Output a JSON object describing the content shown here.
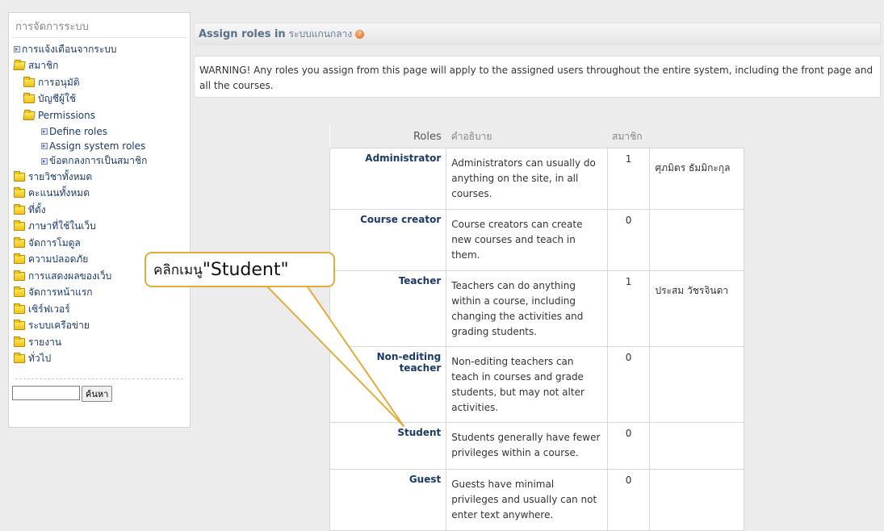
{
  "sidebar": {
    "title": "การจัดการระบบ",
    "items": [
      {
        "label": "การแจ้งเตือนจากระบบ",
        "icon": "doc-icon"
      },
      {
        "label": "สมาชิก",
        "icon": "folder-open-icon"
      },
      {
        "label": "การอนุมัติ",
        "icon": "folder-icon"
      },
      {
        "label": "บัญชีผู้ใช้",
        "icon": "folder-icon"
      },
      {
        "label": "Permissions",
        "icon": "folder-open-icon"
      },
      {
        "label": "Define roles",
        "icon": "doc-icon"
      },
      {
        "label": "Assign system roles",
        "icon": "doc-icon"
      },
      {
        "label": "ข้อตกลงการเป็นสมาชิก",
        "icon": "doc-icon"
      },
      {
        "label": "รายวิชาทั้งหมด",
        "icon": "folder-icon"
      },
      {
        "label": "คะแนนทั้งหมด",
        "icon": "folder-icon"
      },
      {
        "label": "ที่ตั้ง",
        "icon": "folder-icon"
      },
      {
        "label": "ภาษาที่ใช้ในเว็บ",
        "icon": "folder-icon"
      },
      {
        "label": "จัดการโมดูล",
        "icon": "folder-icon"
      },
      {
        "label": "ความปลอดภัย",
        "icon": "folder-icon"
      },
      {
        "label": "การแสดงผลของเว็บ",
        "icon": "folder-icon"
      },
      {
        "label": "จัดการหน้าแรก",
        "icon": "folder-icon"
      },
      {
        "label": "เซิร์ฟเวอร์",
        "icon": "folder-icon"
      },
      {
        "label": "ระบบเครือข่าย",
        "icon": "folder-icon"
      },
      {
        "label": "รายงาน",
        "icon": "folder-icon"
      },
      {
        "label": "ทั่วไป",
        "icon": "folder-icon"
      }
    ],
    "search": {
      "value": "",
      "button_label": "ค้นหา"
    }
  },
  "header": {
    "title": "Assign roles in",
    "context": "ระบบแกนกลาง",
    "help_icon": "help-icon"
  },
  "warning": "WARNING! Any roles you assign from this page will apply to the assigned users throughout the entire system, including the front page and all the courses.",
  "roles_table": {
    "headers": {
      "role": "Roles",
      "description": "คำอธิบาย",
      "members": "สมาชิก"
    },
    "rows": [
      {
        "name": "Administrator",
        "description": "Administrators can usually do anything on the site, in all courses.",
        "count": "1",
        "member": "ศุภมิตร ธัมมิกะกุล"
      },
      {
        "name": "Course creator",
        "description": "Course creators can create new courses and teach in them.",
        "count": "0",
        "member": ""
      },
      {
        "name": "Teacher",
        "description": "Teachers can do anything within a course, including changing the activities and grading students.",
        "count": "1",
        "member": "ประสม วัชรจินดา"
      },
      {
        "name": "Non-editing teacher",
        "description": "Non-editing teachers can teach in courses and grade students, but may not alter activities.",
        "count": "0",
        "member": ""
      },
      {
        "name": "Student",
        "description": "Students generally have fewer privileges within a course.",
        "count": "0",
        "member": ""
      },
      {
        "name": "Guest",
        "description": "Guests have minimal privileges and usually can not enter text anywhere.",
        "count": "0",
        "member": ""
      }
    ]
  },
  "callout": {
    "prefix": "คลิกเมนู ",
    "target": "\"Student\""
  },
  "colors": {
    "link": "#1b3a6b",
    "callout_border": "#e2ad3e",
    "header_text": "#5a6f8a"
  }
}
